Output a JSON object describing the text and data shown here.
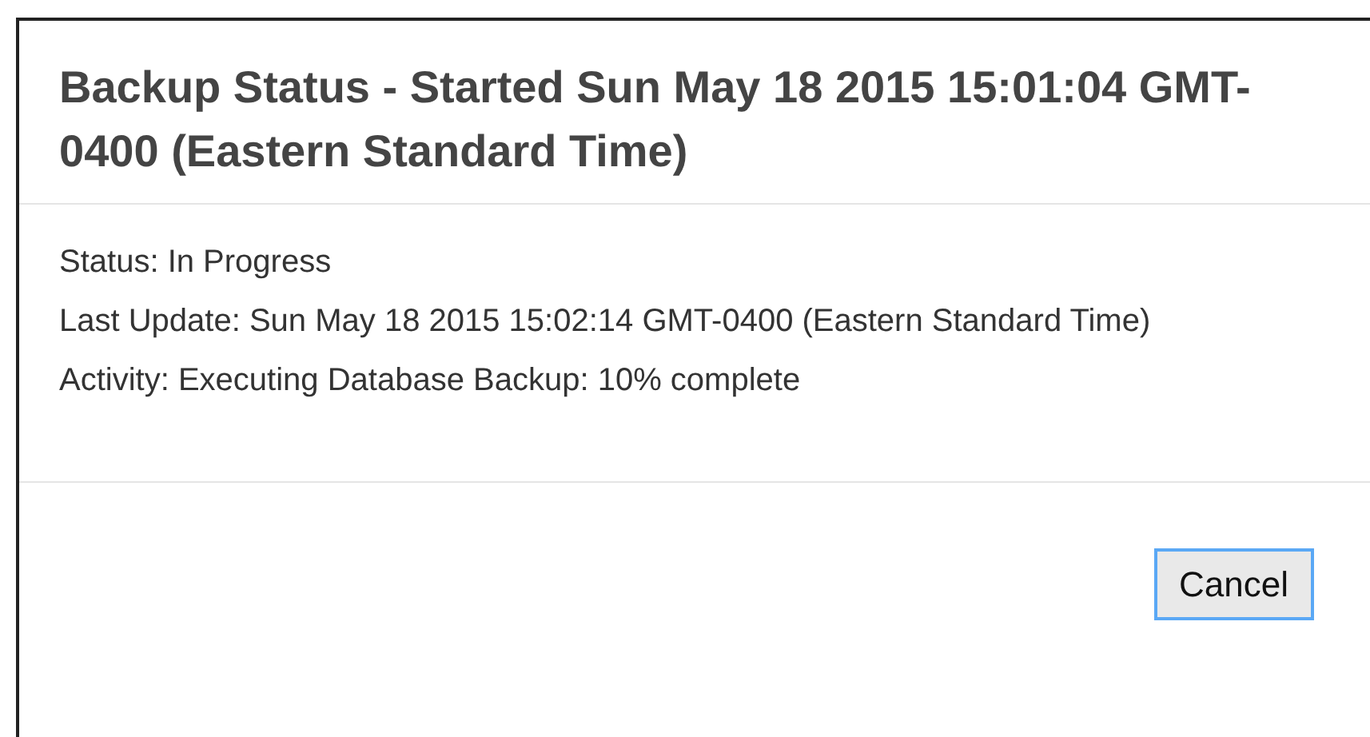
{
  "dialog": {
    "title": "Backup Status - Started Sun May 18 2015 15:01:04 GMT-0400 (Eastern Standard Time)",
    "lines": [
      "Status: In Progress",
      "Last Update: Sun May 18 2015 15:02:14 GMT-0400 (Eastern Standard Time)",
      "Activity: Executing Database Backup: 10% complete"
    ],
    "buttons": [
      {
        "label": "Cancel",
        "focused": true
      }
    ]
  }
}
